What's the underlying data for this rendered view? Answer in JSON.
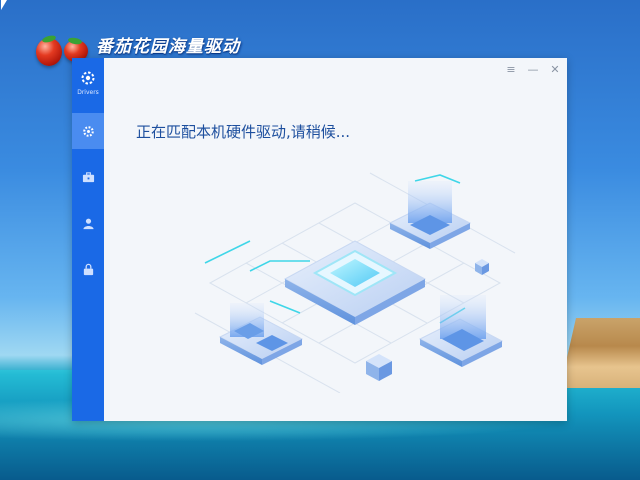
{
  "brand": {
    "title": "番茄花园海量驱动"
  },
  "sidebar": {
    "logo_label": "Drivers",
    "items": [
      {
        "name": "settings",
        "icon": "gear-icon"
      },
      {
        "name": "toolbox",
        "icon": "toolbox-icon"
      },
      {
        "name": "user",
        "icon": "user-icon"
      },
      {
        "name": "lock",
        "icon": "lock-icon"
      }
    ]
  },
  "window": {
    "controls": {
      "menu": "≡",
      "minimize": "—",
      "close": "✕"
    },
    "status_text": "正在匹配本机硬件驱动,请稍候..."
  },
  "colors": {
    "sidebar": "#1a69e6",
    "sidebar_active": "#4a8cf0",
    "status_text": "#1d4f9e",
    "window_bg": "#f3f6fa"
  }
}
